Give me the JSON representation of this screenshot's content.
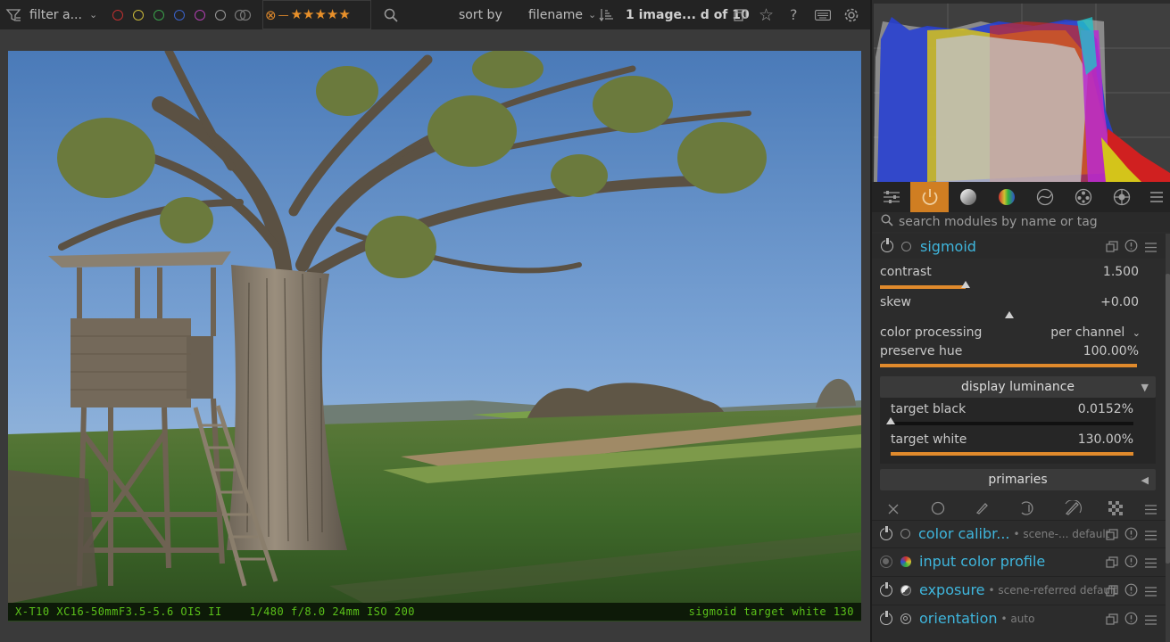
{
  "topbar": {
    "filter_label": "filter a...",
    "sort_label": "sort by",
    "sort_value": "filename",
    "count_text": "1 image... d of 10",
    "color_labels": [
      {
        "name": "red",
        "color": "#c03030"
      },
      {
        "name": "yellow",
        "color": "#c9b83a"
      },
      {
        "name": "green",
        "color": "#3aa04a"
      },
      {
        "name": "blue",
        "color": "#3a62c9"
      },
      {
        "name": "purple",
        "color": "#b040b0"
      },
      {
        "name": "gray",
        "color": "#9a9a9a"
      }
    ],
    "rating_stars": "★★★★★",
    "reject_glyph": "⊗",
    "icons": [
      "filter-icon",
      "search-icon",
      "sort-order-icon",
      "grouping-icon",
      "star-icon",
      "help-icon",
      "keyboard-icon",
      "gear-icon"
    ]
  },
  "image": {
    "overlay_left": "X-T10 XC16-50mmF3.5-5.6 OIS II    1/480 f/8.0 24mm ISO 200",
    "overlay_right": "sigmoid target white 130"
  },
  "right_panel": {
    "tabs": [
      "quick-access-icon",
      "active-modules-icon",
      "base-icon",
      "color-icon",
      "correct-icon",
      "effect-icon",
      "technical-icon",
      "presets-menu-icon"
    ],
    "search_placeholder": "search modules by name or tag",
    "module": {
      "name": "sigmoid",
      "params": [
        {
          "label": "contrast",
          "value": "1.500",
          "fraction": 0.33
        },
        {
          "label": "skew",
          "value": "+0.00",
          "fraction": 0.5
        }
      ],
      "color_processing_label": "color processing",
      "color_processing_value": "per channel",
      "preserve_hue": {
        "label": "preserve hue",
        "value": "100.00%",
        "fraction": 1.0
      },
      "display_luminance": {
        "title": "display luminance",
        "target_black": {
          "label": "target black",
          "value": "0.0152%",
          "fraction": 0.0
        },
        "target_white": {
          "label": "target white",
          "value": "130.00%",
          "fraction": 1.0
        }
      },
      "primaries_title": "primaries"
    },
    "mask_icons": [
      "no-mask-icon",
      "uniform-mask-icon",
      "drawn-mask-icon",
      "parametric-mask-icon",
      "drawn-parametric-mask-icon",
      "raster-mask-icon",
      "blend-menu-icon"
    ],
    "modules": [
      {
        "name": "color calibr...",
        "sub": "• scene-... default"
      },
      {
        "name": "input color profile",
        "sub": ""
      },
      {
        "name": "exposure",
        "sub": "• scene-referred default"
      },
      {
        "name": "orientation",
        "sub": "• auto"
      }
    ]
  },
  "colors": {
    "accent_orange": "#e08a2c",
    "module_blue": "#3fb6dd",
    "overlay_green": "#5bc21a"
  }
}
